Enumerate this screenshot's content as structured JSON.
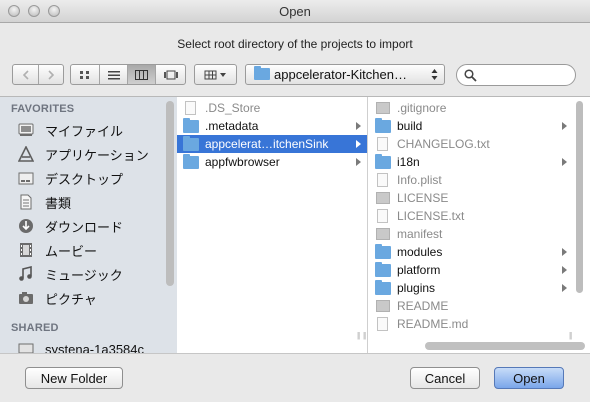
{
  "window": {
    "title": "Open",
    "prompt": "Select root directory of the projects to import"
  },
  "toolbar": {
    "back_icon": "chevron-left-icon",
    "forward_icon": "chevron-right-icon",
    "view_modes": [
      "icon-view",
      "list-view",
      "column-view",
      "coverflow-view"
    ],
    "selected_view": "column-view",
    "location": "appcelerator-Kitchen…",
    "search_placeholder": ""
  },
  "sidebar": {
    "favorites_header": "FAVORITES",
    "favorites": [
      {
        "label": "マイファイル",
        "icon": "my-files-icon"
      },
      {
        "label": "アプリケーション",
        "icon": "applications-icon"
      },
      {
        "label": "デスクトップ",
        "icon": "desktop-icon"
      },
      {
        "label": "書類",
        "icon": "documents-icon"
      },
      {
        "label": "ダウンロード",
        "icon": "downloads-icon"
      },
      {
        "label": "ムービー",
        "icon": "movies-icon"
      },
      {
        "label": "ミュージック",
        "icon": "music-icon"
      },
      {
        "label": "ピクチャ",
        "icon": "pictures-icon"
      }
    ],
    "shared_header": "SHARED",
    "shared": [
      {
        "label": "systena-1a3584c",
        "icon": "network-computer-icon"
      }
    ]
  },
  "columns": {
    "first": [
      {
        "label": ".DS_Store",
        "kind": "file",
        "dim": true
      },
      {
        "label": ".metadata",
        "kind": "folder",
        "has_children": true
      },
      {
        "label": "appcelerat…itchenSink",
        "kind": "folder",
        "has_children": true,
        "selected": true
      },
      {
        "label": "appfwbrowser",
        "kind": "folder",
        "has_children": true
      }
    ],
    "second": [
      {
        "label": ".gitignore",
        "kind": "gray-file",
        "dim": true
      },
      {
        "label": "build",
        "kind": "folder",
        "has_children": true
      },
      {
        "label": "CHANGELOG.txt",
        "kind": "file",
        "dim": true
      },
      {
        "label": "i18n",
        "kind": "folder",
        "has_children": true
      },
      {
        "label": "Info.plist",
        "kind": "file",
        "dim": true
      },
      {
        "label": "LICENSE",
        "kind": "gray-file",
        "dim": true
      },
      {
        "label": "LICENSE.txt",
        "kind": "file",
        "dim": true
      },
      {
        "label": "manifest",
        "kind": "gray-file",
        "dim": true
      },
      {
        "label": "modules",
        "kind": "folder",
        "has_children": true
      },
      {
        "label": "platform",
        "kind": "folder",
        "has_children": true
      },
      {
        "label": "plugins",
        "kind": "folder",
        "has_children": true
      },
      {
        "label": "README",
        "kind": "gray-file",
        "dim": true
      },
      {
        "label": "README.md",
        "kind": "file",
        "dim": true
      }
    ]
  },
  "buttons": {
    "new_folder": "New Folder",
    "cancel": "Cancel",
    "open": "Open"
  },
  "colors": {
    "selection": "#3875d7",
    "folder": "#6aa8e0",
    "sidebar_bg": "#dde2e8",
    "open_button": "#7aa6ea"
  }
}
